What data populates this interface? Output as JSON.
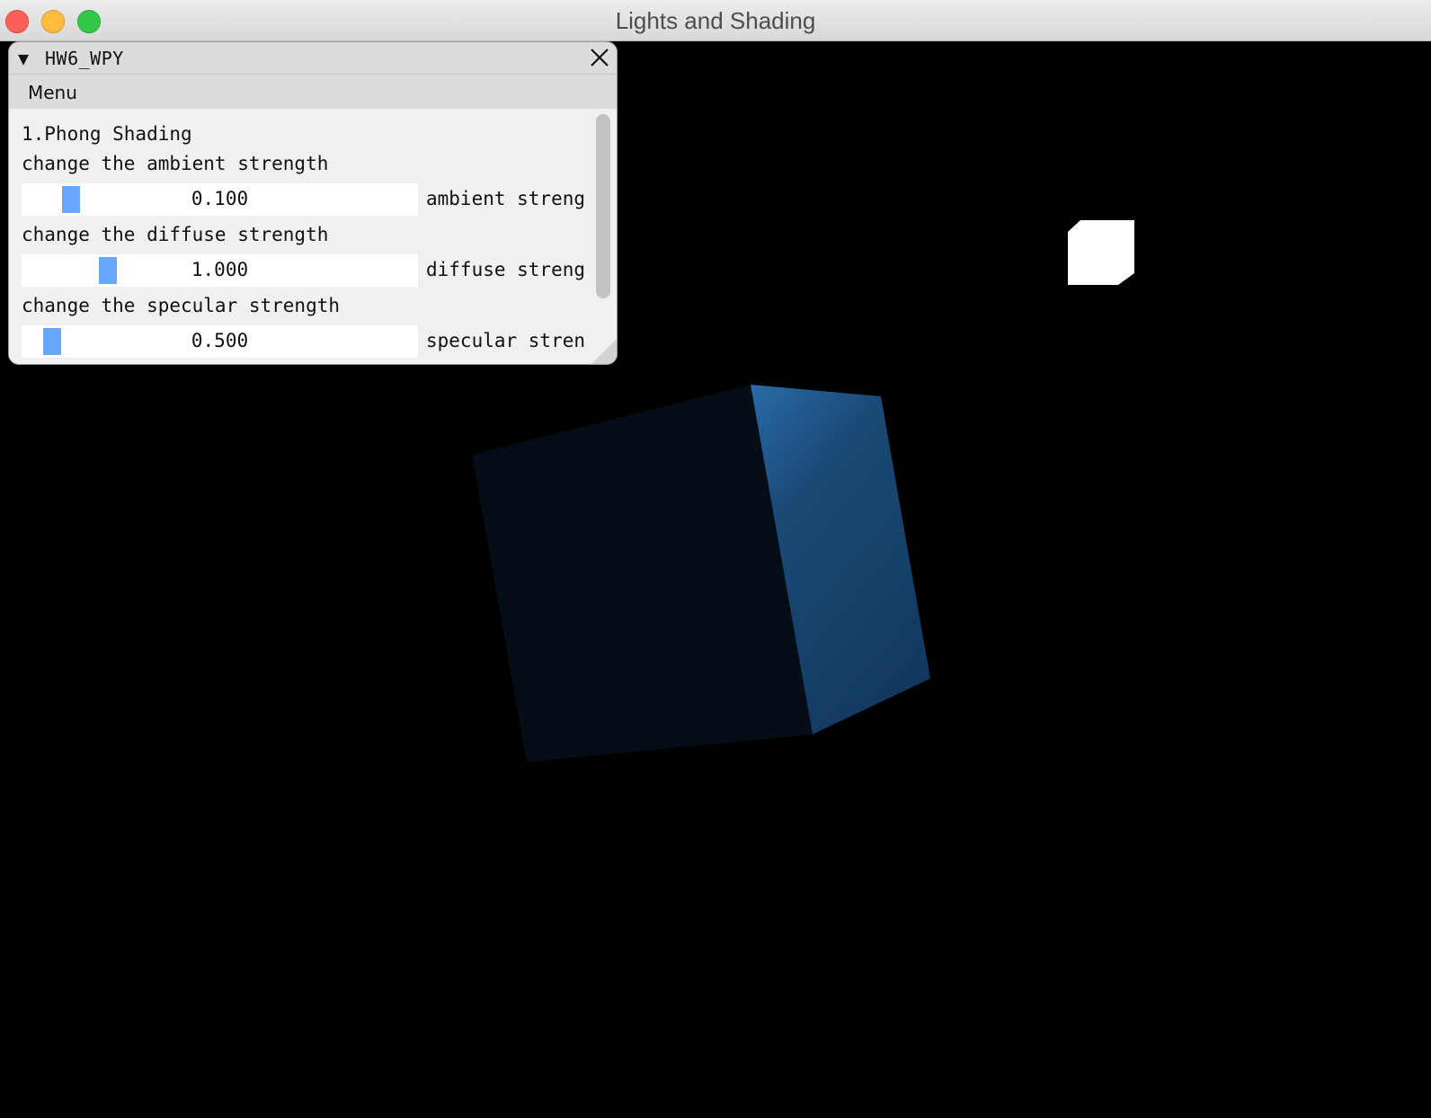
{
  "window": {
    "title": "Lights and Shading"
  },
  "panel": {
    "title": "HW6_WPY",
    "menu": "Menu",
    "section_heading": "1.Phong Shading",
    "controls": [
      {
        "caption": "change the ambient strength",
        "value": "0.100",
        "label": "ambient strength",
        "level": 0.1
      },
      {
        "caption": "change the diffuse strength",
        "value": "1.000",
        "label": "diffuse strength",
        "level": 1.0
      },
      {
        "caption": "change the specular strength",
        "value": "0.500",
        "label": "specular strength",
        "level": 0.5
      }
    ]
  },
  "colors": {
    "background": "#000000",
    "panel_bg": "#f0f0f0",
    "slider_grab": "#66a6ff",
    "cube_front": "#050e17",
    "cube_side": "#1a4a76",
    "light_cube": "#ffffff"
  },
  "icons": {
    "collapse": "triangle-down-icon",
    "close": "close-x-icon",
    "resize": "resize-grip-icon"
  }
}
